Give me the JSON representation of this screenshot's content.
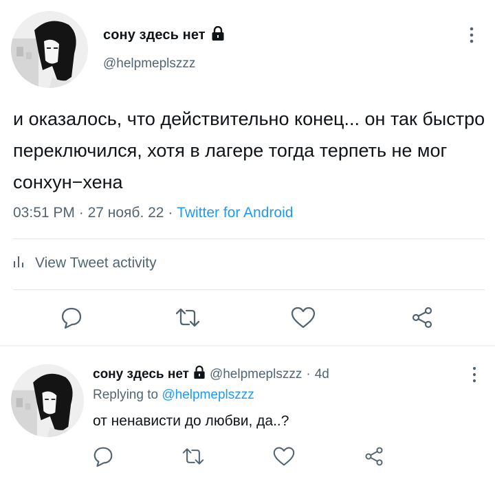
{
  "tweet": {
    "display_name": "сону здесь нет",
    "handle": "@helpmeplszzz",
    "text": "и оказалось, что действительно конец... он так быстро переключился, хотя в лагере тогда терпеть не мог сонхун−хена",
    "time": "03:51 PM",
    "sep1": "·",
    "date": "27 нояб. 22",
    "sep2": "·",
    "source": "Twitter for Android",
    "activity_label": "View Tweet activity"
  },
  "reply": {
    "display_name": "сону здесь нет",
    "handle": "@helpmeplszzz",
    "sep": "·",
    "age": "4d",
    "replying_prefix": "Replying to",
    "replying_to": "@helpmeplszzz",
    "text": "от ненависти до любви, да..?"
  },
  "icons": [
    "lock-icon",
    "more-icon",
    "analytics-icon",
    "reply-icon",
    "retweet-icon",
    "like-icon",
    "share-icon"
  ],
  "colors": {
    "accent": "#1d9bf0",
    "text": "#0f1419",
    "secondary": "#536471",
    "divider": "#e1e6ea"
  }
}
